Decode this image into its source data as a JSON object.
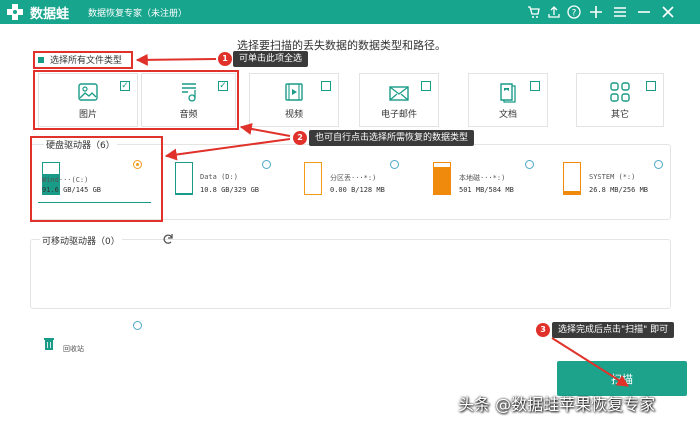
{
  "app": {
    "name": "数据蛙",
    "subtitle": "数据恢复专家（未注册）"
  },
  "titlebar_icons": [
    "cart-icon",
    "share-icon",
    "help-icon",
    "add-icon",
    "menu-icon",
    "minimize-icon",
    "close-icon"
  ],
  "instruction": "选择要扫描的丢失数据的数据类型和路径。",
  "select_all_label": "选择所有文件类型",
  "file_types": [
    {
      "label": "图片",
      "icon": "image-icon",
      "checked": true
    },
    {
      "label": "音频",
      "icon": "audio-icon",
      "checked": true
    },
    {
      "label": "视频",
      "icon": "video-icon",
      "checked": false
    },
    {
      "label": "电子邮件",
      "icon": "email-icon",
      "checked": false
    },
    {
      "label": "文档",
      "icon": "document-icon",
      "checked": false
    },
    {
      "label": "其它",
      "icon": "other-icon",
      "checked": false
    }
  ],
  "drives_title": "硬盘驱动器（6）",
  "drives": [
    {
      "name": "Wind···(C:)",
      "size": "91.6 GB/145 GB",
      "selected": true,
      "used_fraction": 0.63,
      "fill_color": "#1a9b88"
    },
    {
      "name": "Data (D:)",
      "size": "10.8 GB/329 GB",
      "selected": false,
      "used_fraction": 0.03,
      "fill_color": "#1a9b88"
    },
    {
      "name": "分区丢···*:)",
      "size": "0.00  B/128 MB",
      "selected": false,
      "used_fraction": 0.0,
      "fill_color": "#f39a19"
    },
    {
      "name": "本地磁···*:)",
      "size": "501 MB/584 MB",
      "selected": false,
      "used_fraction": 0.86,
      "fill_color": "#f08a0c"
    },
    {
      "name": "SYSTEM (*:)",
      "size": "26.8 MB/256 MB",
      "selected": false,
      "used_fraction": 0.1,
      "fill_color": "#f08a0c"
    }
  ],
  "removable_title": "可移动驱动器（0）",
  "recycle_label": "回收站",
  "scan_label": "扫描",
  "annotations": [
    {
      "num": "1",
      "text": "可单击此项全选"
    },
    {
      "num": "2",
      "text": "也可自行点击选择所需恢复的数据类型"
    },
    {
      "num": "3",
      "text": "选择完成后点击\"扫描\" 即可"
    }
  ],
  "watermark": "头条 @数据蛙苹果恢复专家",
  "colors": {
    "accent": "#18a58d",
    "annotation_red": "#e0322a",
    "selected_radio": "#f39a19"
  }
}
